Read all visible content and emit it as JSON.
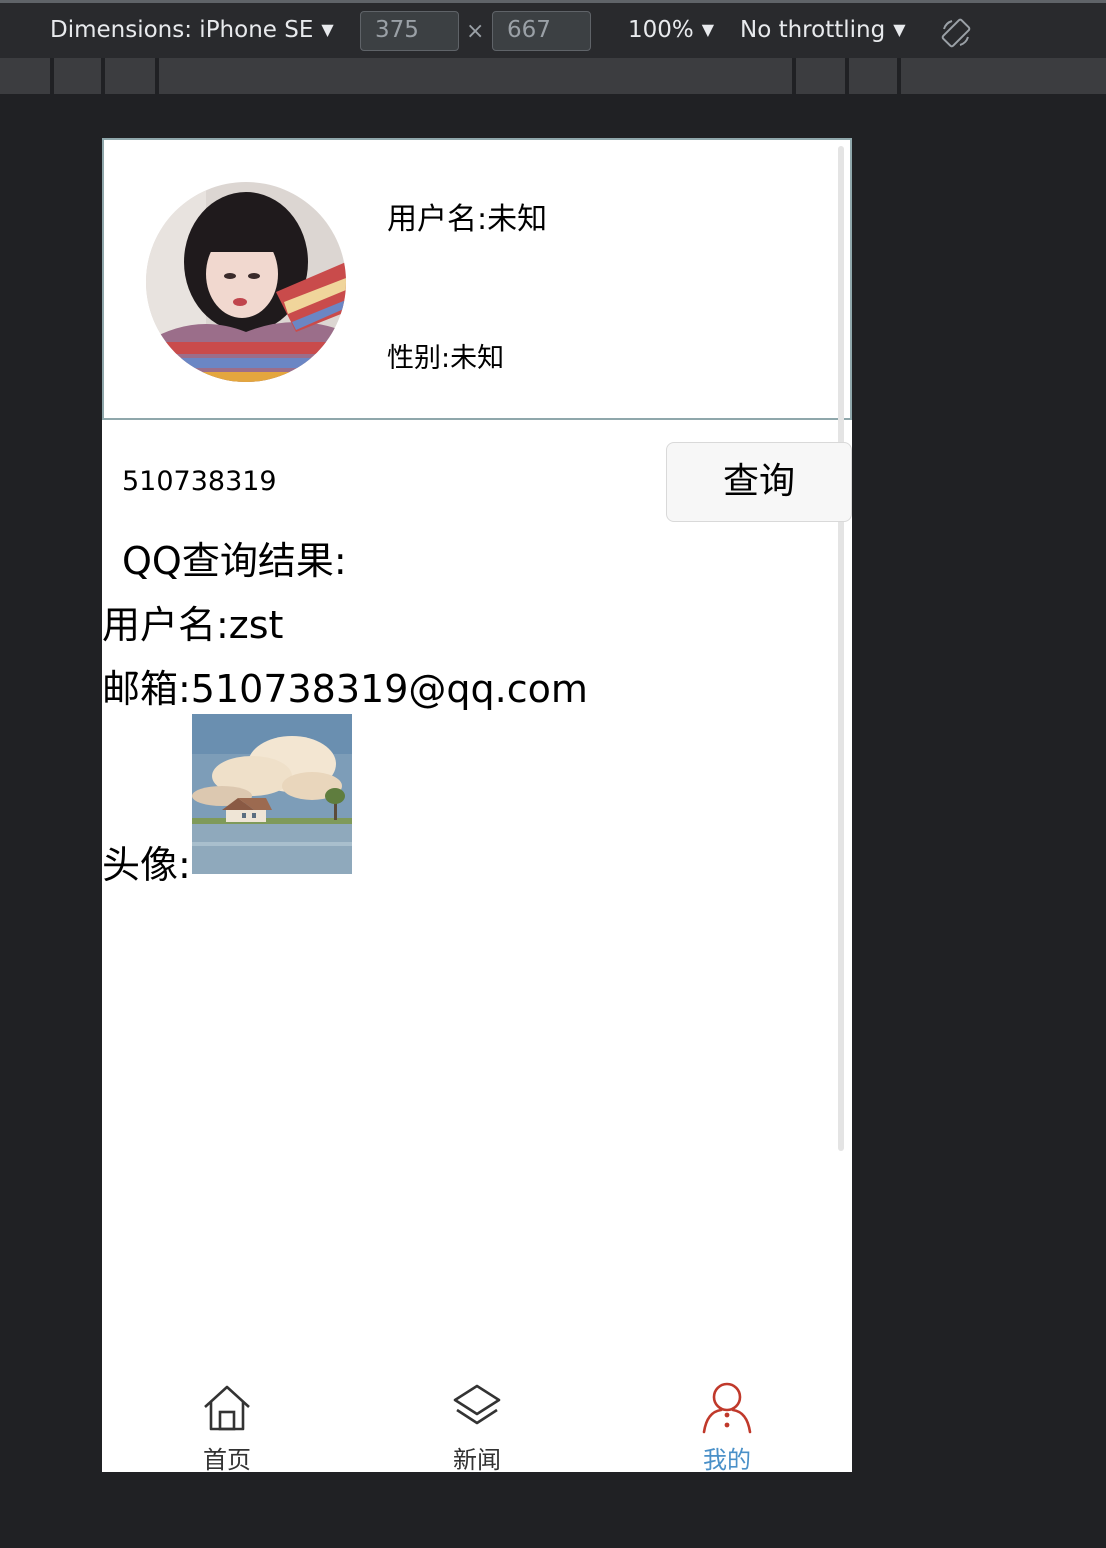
{
  "devtools": {
    "dimensions_label": "Dimensions: iPhone SE",
    "width_value": "375",
    "height_value": "667",
    "times": "×",
    "zoom": "100%",
    "throttling": "No throttling"
  },
  "profile": {
    "username": "用户名:未知",
    "gender": "性别:未知"
  },
  "search": {
    "qq_value": "510738319",
    "button_label": "查询"
  },
  "result": {
    "title": "QQ查询结果:",
    "username": "用户名:zst",
    "email": "邮箱:510738319@qq.com",
    "avatar_label": "头像:"
  },
  "tabs": [
    {
      "label": "首页",
      "icon": "home-icon",
      "color": "#333333"
    },
    {
      "label": "新闻",
      "icon": "layers-icon",
      "color": "#333333"
    },
    {
      "label": "我的",
      "icon": "user-icon",
      "color": "#4a90c8",
      "icon_color": "#c0392b",
      "active": true
    }
  ]
}
